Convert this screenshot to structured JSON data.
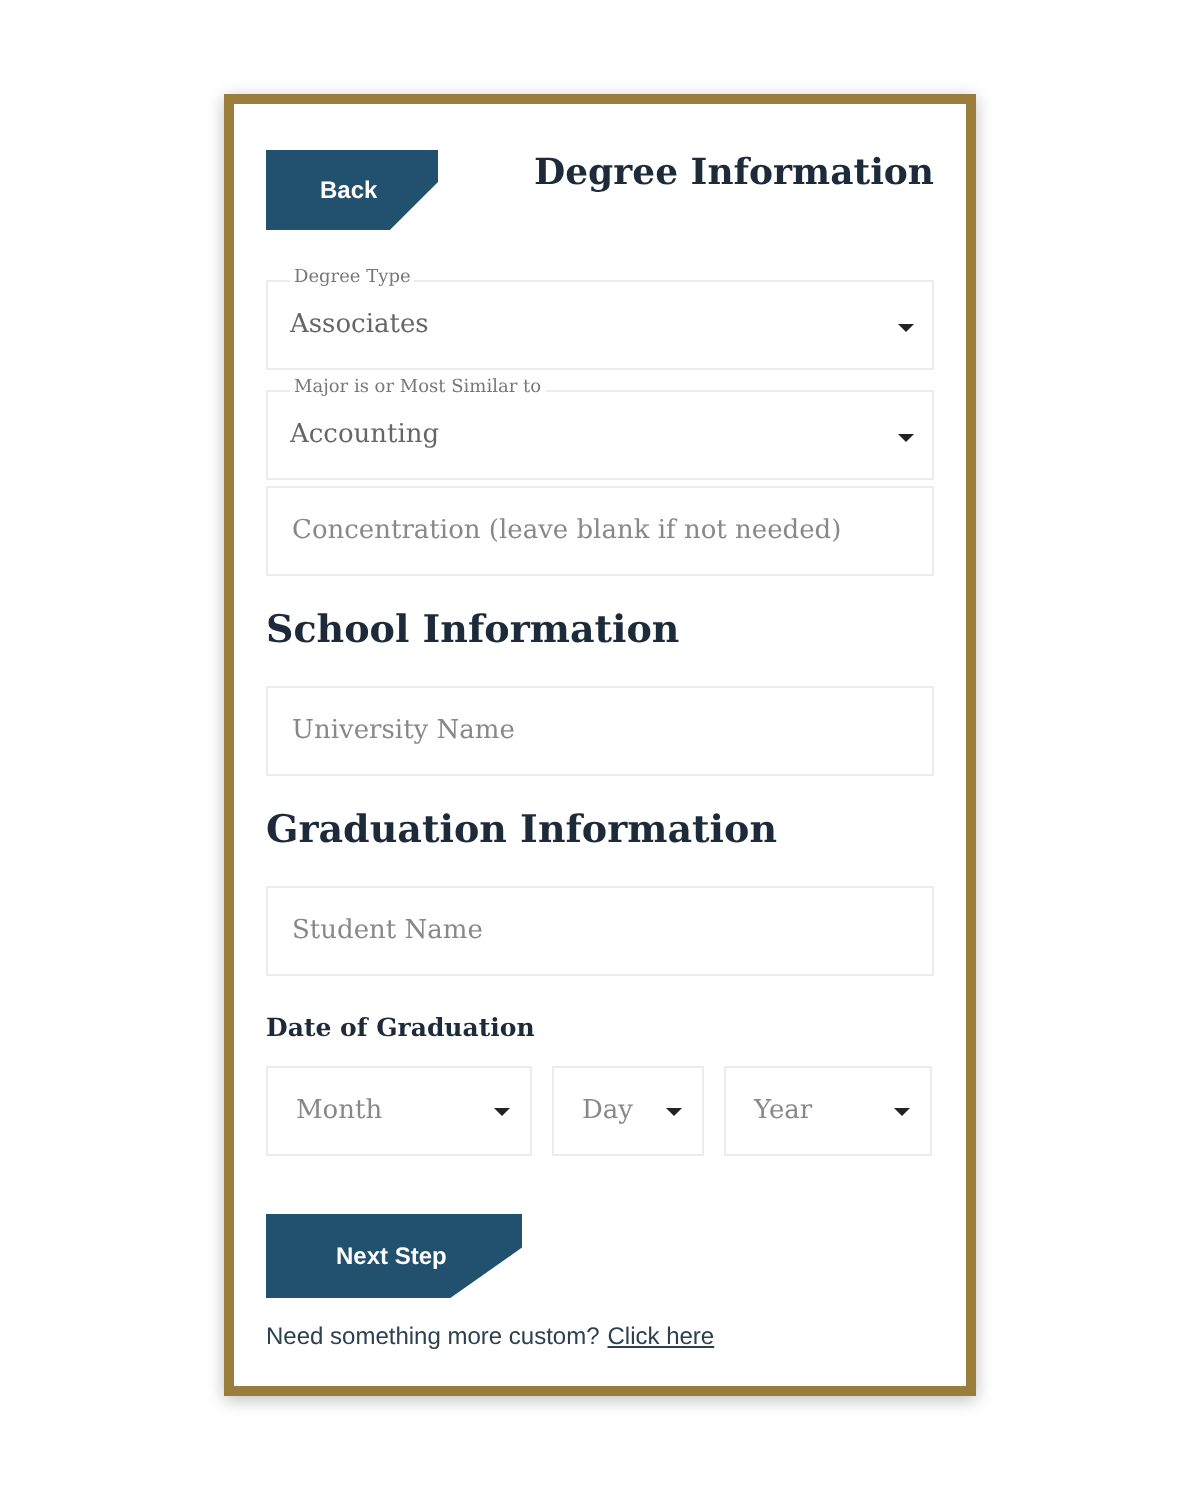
{
  "back_button": "Back",
  "title": "Degree Information",
  "degree_fields": [
    {
      "kind": "select",
      "label": "Degree Type",
      "value": "Associates"
    },
    {
      "kind": "select",
      "label": "Major is or Most Similar to",
      "value": "Accounting"
    },
    {
      "kind": "text",
      "placeholder": "Concentration (leave blank if not needed)"
    }
  ],
  "school_section": {
    "heading": "School Information",
    "fields": [
      {
        "kind": "text",
        "placeholder": "University Name"
      }
    ]
  },
  "graduation_section": {
    "heading": "Graduation Information",
    "fields": [
      {
        "kind": "text",
        "placeholder": "Student Name"
      }
    ],
    "date_label": "Date of Graduation",
    "date_selects": [
      {
        "placeholder": "Month"
      },
      {
        "placeholder": "Day"
      },
      {
        "placeholder": "Year"
      }
    ]
  },
  "next_button": "Next Step",
  "footer": {
    "text": "Need something more custom?",
    "link": "Click here"
  }
}
